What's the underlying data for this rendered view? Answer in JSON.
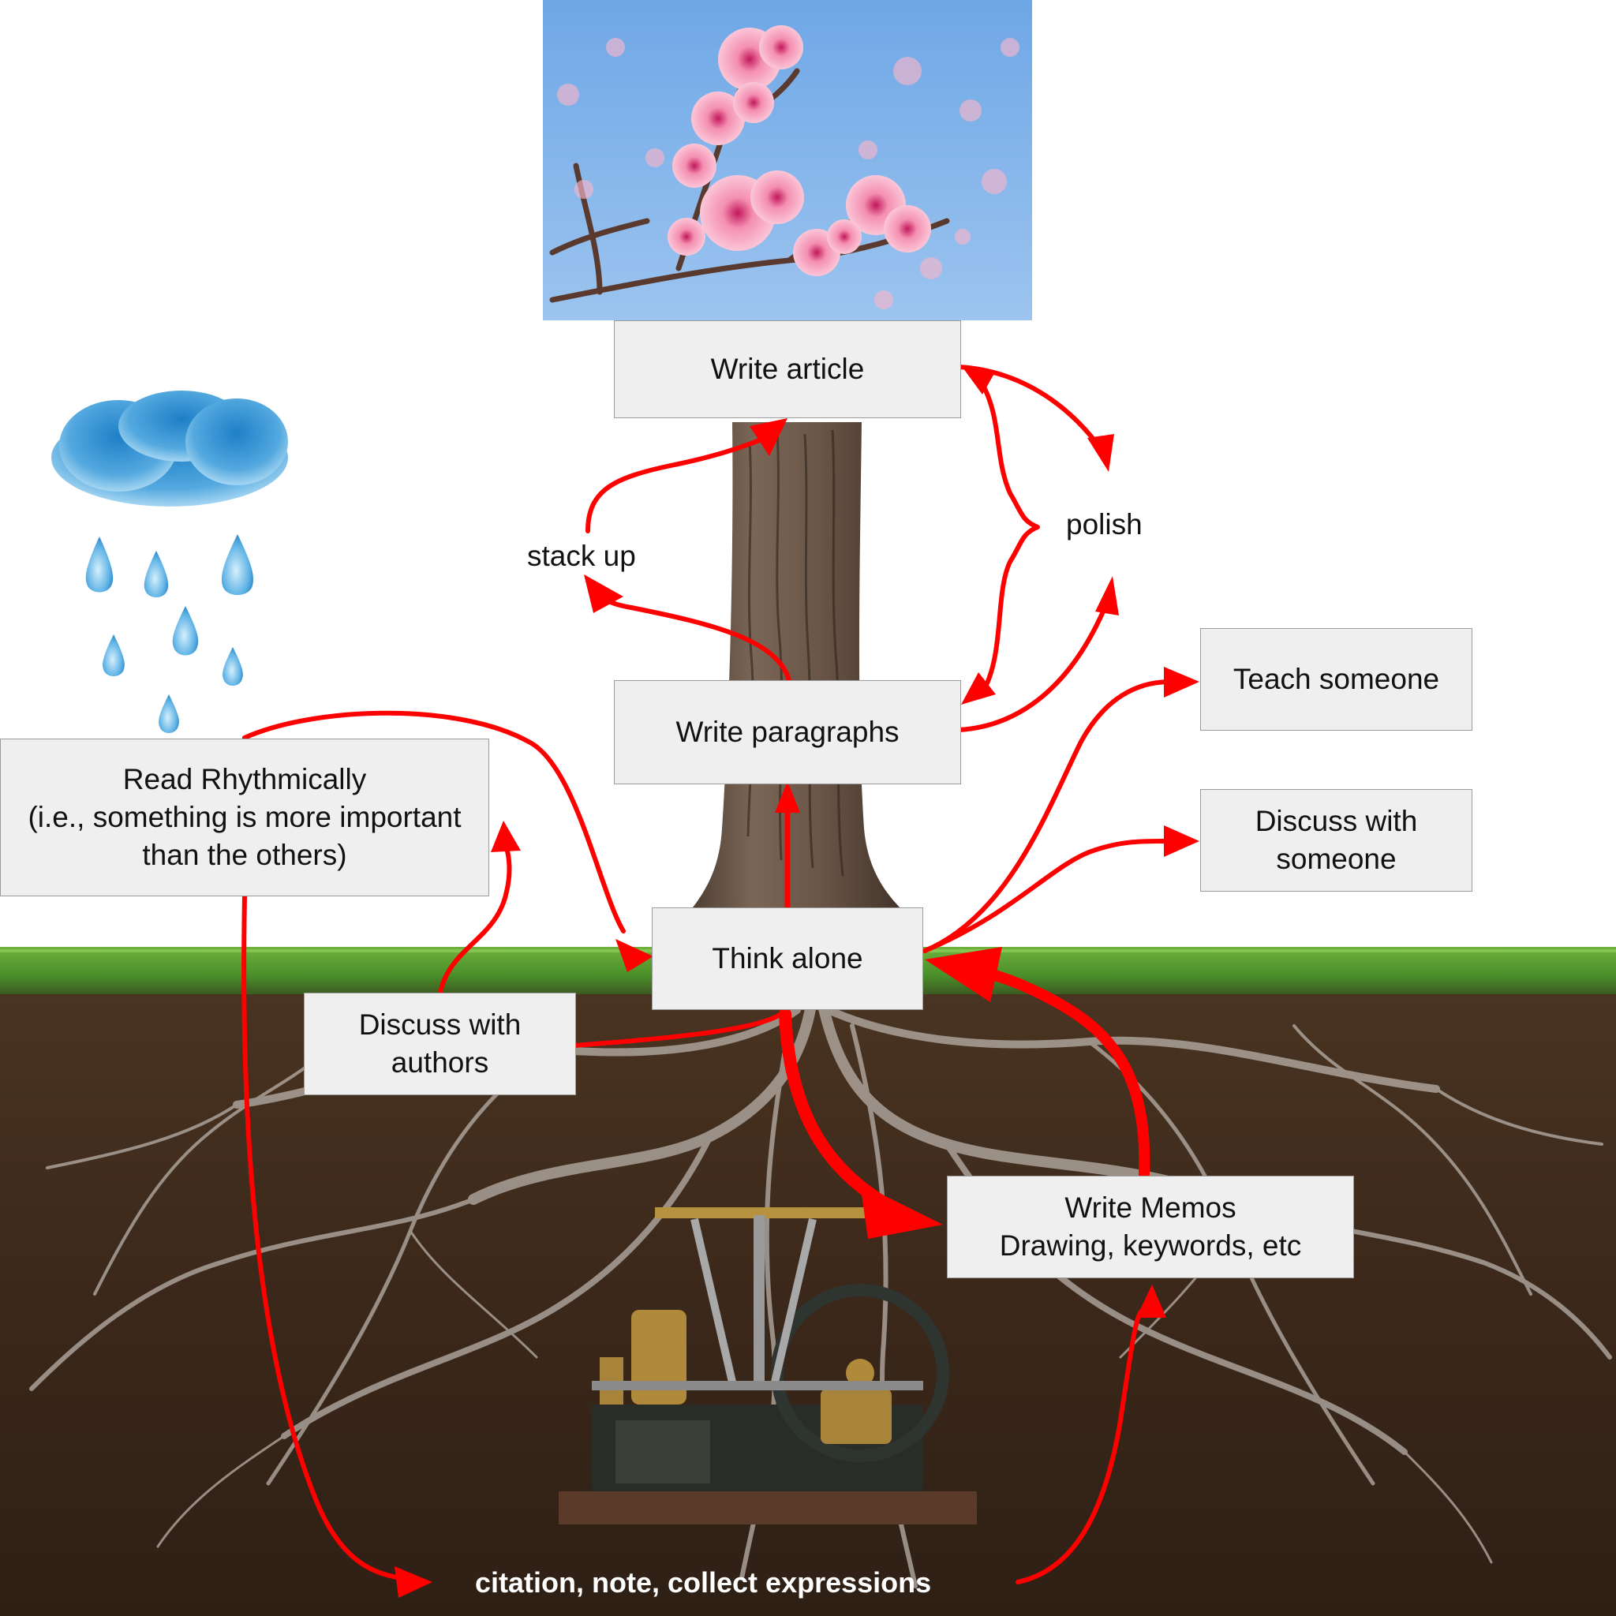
{
  "nodes": {
    "write_article": "Write article",
    "write_paragraphs": "Write paragraphs",
    "think_alone": "Think alone",
    "read_rhythmically": "Read Rhythmically\n(i.e., something is more important\nthan the others)",
    "discuss_authors": "Discuss with\nauthors",
    "teach_someone": "Teach someone",
    "discuss_someone": "Discuss with\nsomeone",
    "write_memos": "Write Memos\nDrawing, keywords, etc"
  },
  "labels": {
    "stack_up": "stack up",
    "polish": "polish",
    "citation": "citation, note, collect expressions"
  },
  "colors": {
    "arrow": "#ff0000",
    "box_fill": "#efefef",
    "box_border": "#9c9c9c",
    "grass": "#4f9a2c",
    "soil": "#3e2a1c",
    "sky": "#7fb3ea",
    "blossom": "#f4a6c0"
  },
  "icons": {
    "blossom": "cherry-blossom-photo",
    "cloud": "rain-cloud-icon",
    "trunk": "tree-trunk",
    "roots": "tree-roots",
    "engine": "steam-engine-model"
  }
}
